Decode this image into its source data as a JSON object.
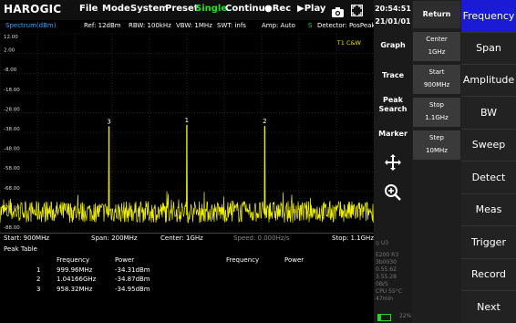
{
  "topbar": {
    "logo": "HAROGIC",
    "menu": [
      "File",
      "Mode",
      "System",
      "Preset"
    ],
    "single": "Single",
    "continu": "Continu.",
    "rec": "Rec",
    "play": "Play"
  },
  "datetime": {
    "time": "20:54:51",
    "date": "21/01/01"
  },
  "info": {
    "label": "Spectrum(dBm)",
    "ref": "Ref: 12dBm",
    "rbw": "RBW: 100kHz",
    "vbw": "VBW: 1MHz",
    "swt": "SWT: infs",
    "amp": "Amp: Auto",
    "s": "S",
    "detector": "Detector: PosPeak"
  },
  "trace_label": "T1 C&W",
  "axis": {
    "start": "Start: 900MHz",
    "span": "Span: 200MHz",
    "center": "Center: 1GHz",
    "speed": "Speed: 0.000Hz/s",
    "stop": "Stop: 1.1GHz"
  },
  "peak_table": {
    "title": "Peak Table",
    "headers": [
      "Frequency",
      "Power",
      "Frequency",
      "Power"
    ],
    "rows": [
      {
        "idx": "1",
        "freq": "999.96MHz",
        "power": "-34.31dBm"
      },
      {
        "idx": "2",
        "freq": "1.04166GHz",
        "power": "-34.87dBm"
      },
      {
        "idx": "3",
        "freq": "958.32MHz",
        "power": "-34.95dBm"
      }
    ]
  },
  "mid_buttons": [
    "Return",
    "Graph",
    "Trace",
    "Peak Search",
    "Marker"
  ],
  "value_boxes": [
    {
      "label": "Center",
      "value": "1GHz"
    },
    {
      "label": "Start",
      "value": "900MHz"
    },
    {
      "label": "Stop",
      "value": "1.1GHz"
    },
    {
      "label": "Step",
      "value": "10MHz"
    }
  ],
  "right_menu": [
    "Frequency",
    "Span",
    "Amplitude",
    "BW",
    "Sweep",
    "Detect",
    "Meas",
    "Trigger",
    "Record",
    "Next"
  ],
  "status": {
    "u": "U3",
    "lines": [
      "E200 R3",
      "3b0030",
      "0.55.62",
      "3.55.28",
      "0B/S",
      "CPU 55°C",
      "47min"
    ],
    "battery": "22%"
  },
  "chart_data": {
    "type": "line",
    "title": "",
    "ylabel": "Spectrum(dBm)",
    "xlabel": "",
    "xlim": [
      900,
      1100
    ],
    "ylim": [
      -88,
      12
    ],
    "yticks": [
      "12.00",
      "2.00",
      "-8.00",
      "-18.00",
      "-28.00",
      "-38.00",
      "-48.00",
      "-58.00",
      "-68.00",
      "-78.00",
      "-88.00"
    ],
    "grid": true,
    "noise_floor_dBm": -80,
    "peaks": [
      {
        "label": "1",
        "x": 999.96,
        "y": -34.31
      },
      {
        "label": "2",
        "x": 1041.66,
        "y": -34.87
      },
      {
        "label": "3",
        "x": 958.32,
        "y": -34.95
      }
    ],
    "trace_color": "#f0f000"
  }
}
